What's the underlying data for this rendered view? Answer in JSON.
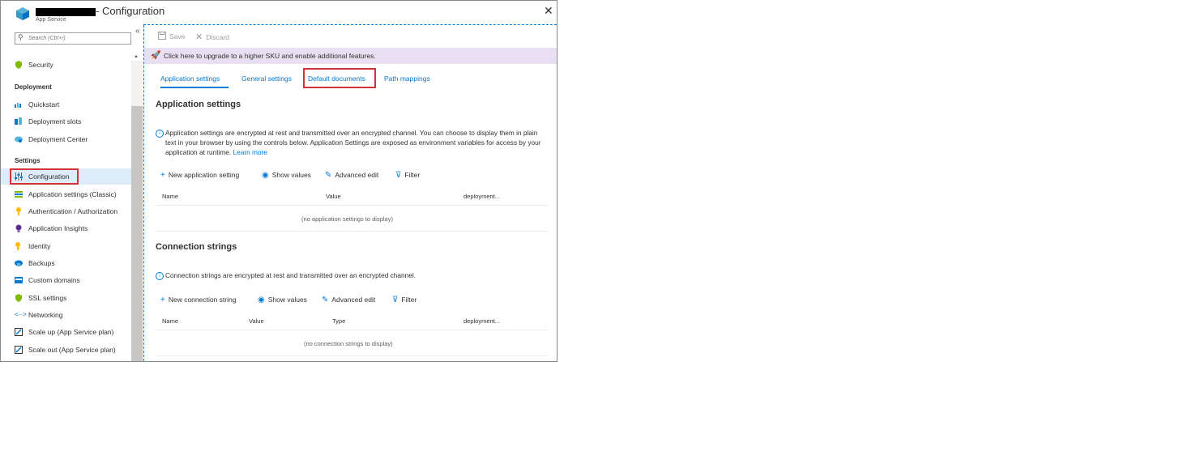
{
  "window": {
    "title": "- Configuration",
    "subtitle": "App Service",
    "close_glyph": "✕"
  },
  "sidebar": {
    "search_placeholder": "Search (Ctrl+/)",
    "collapse_glyph": "«",
    "items": [
      {
        "label": "Security",
        "icon": "shield-icon",
        "color": "#7fba00"
      },
      {
        "label": "Quickstart",
        "icon": "cloud-bolt-icon",
        "color": "#0078d4"
      },
      {
        "label": "Deployment slots",
        "icon": "slots-icon",
        "color": "#0078d4"
      },
      {
        "label": "Deployment Center",
        "icon": "cloud-deploy-icon",
        "color": "#0078d4"
      },
      {
        "label": "Configuration",
        "icon": "sliders-icon",
        "color": "#605e5c"
      },
      {
        "label": "Application settings (Classic)",
        "icon": "list-settings-icon",
        "color": "#7fba00"
      },
      {
        "label": "Authentication / Authorization",
        "icon": "key-icon",
        "color": "#ffb900"
      },
      {
        "label": "Application Insights",
        "icon": "lightbulb-icon",
        "color": "#5c2d91"
      },
      {
        "label": "Identity",
        "icon": "identity-key-icon",
        "color": "#ffb900"
      },
      {
        "label": "Backups",
        "icon": "backup-icon",
        "color": "#0078d4"
      },
      {
        "label": "Custom domains",
        "icon": "domain-icon",
        "color": "#0078d4"
      },
      {
        "label": "SSL settings",
        "icon": "ssl-shield-icon",
        "color": "#7fba00"
      },
      {
        "label": "Networking",
        "icon": "network-icon",
        "color": "#0078d4"
      },
      {
        "label": "Scale up (App Service plan)",
        "icon": "scale-up-icon",
        "color": "#323130"
      },
      {
        "label": "Scale out (App Service plan)",
        "icon": "scale-out-icon",
        "color": "#323130"
      }
    ],
    "groups": {
      "deployment": "Deployment",
      "settings": "Settings"
    }
  },
  "toolbar": {
    "save": "Save",
    "discard": "Discard"
  },
  "banner": {
    "text": "Click here to upgrade to a higher SKU and enable additional features."
  },
  "tabs": [
    {
      "label": "Application settings",
      "selected": true
    },
    {
      "label": "General settings",
      "selected": false
    },
    {
      "label": "Default documents",
      "selected": false
    },
    {
      "label": "Path mappings",
      "selected": false
    }
  ],
  "app_settings": {
    "heading": "Application settings",
    "info": "Application settings are encrypted at rest and transmitted over an encrypted channel. You can choose to display them in plain text in your browser by using the controls below. Application Settings are exposed as environment variables for access by your application at runtime.",
    "learn_more": "Learn more",
    "commands": {
      "new": "New application setting",
      "show": "Show values",
      "advanced": "Advanced edit",
      "filter": "Filter"
    },
    "columns": [
      "Name",
      "Value",
      "deployment..."
    ],
    "empty": "(no application settings to display)"
  },
  "conn_strings": {
    "heading": "Connection strings",
    "info": "Connection strings are encrypted at rest and transmitted over an encrypted channel.",
    "commands": {
      "new": "New connection string",
      "show": "Show values",
      "advanced": "Advanced edit",
      "filter": "Filter"
    },
    "columns": [
      "Name",
      "Value",
      "Type",
      "deployment..."
    ],
    "empty": "(no connection strings to display)"
  },
  "colors": {
    "accent": "#0078d4",
    "highlight": "#d13438",
    "banner_bg": "#e8e0f2"
  }
}
